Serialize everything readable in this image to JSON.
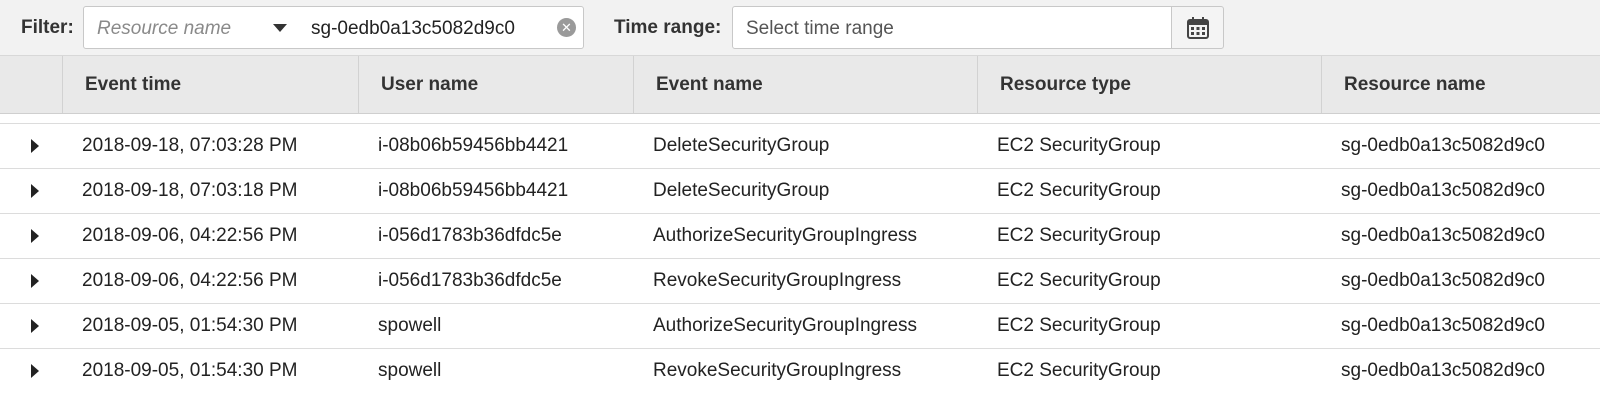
{
  "filter": {
    "label": "Filter:",
    "attribute_placeholder": "Resource name",
    "value": "sg-0edb0a13c5082d9c0",
    "clear_glyph": "✕"
  },
  "time_range": {
    "label": "Time range:",
    "placeholder": "Select time range",
    "icon": "calendar-icon"
  },
  "table": {
    "columns": [
      "Event time",
      "User name",
      "Event name",
      "Resource type",
      "Resource name"
    ],
    "rows": [
      {
        "event_time": "2018-09-18, 07:03:28 PM",
        "user_name": "i-08b06b59456bb4421",
        "event_name": "DeleteSecurityGroup",
        "resource_type": "EC2 SecurityGroup",
        "resource_name": "sg-0edb0a13c5082d9c0"
      },
      {
        "event_time": "2018-09-18, 07:03:18 PM",
        "user_name": "i-08b06b59456bb4421",
        "event_name": "DeleteSecurityGroup",
        "resource_type": "EC2 SecurityGroup",
        "resource_name": "sg-0edb0a13c5082d9c0"
      },
      {
        "event_time": "2018-09-06, 04:22:56 PM",
        "user_name": "i-056d1783b36dfdc5e",
        "event_name": "AuthorizeSecurityGroupIngress",
        "resource_type": "EC2 SecurityGroup",
        "resource_name": "sg-0edb0a13c5082d9c0"
      },
      {
        "event_time": "2018-09-06, 04:22:56 PM",
        "user_name": "i-056d1783b36dfdc5e",
        "event_name": "RevokeSecurityGroupIngress",
        "resource_type": "EC2 SecurityGroup",
        "resource_name": "sg-0edb0a13c5082d9c0"
      },
      {
        "event_time": "2018-09-05, 01:54:30 PM",
        "user_name": "spowell",
        "event_name": "AuthorizeSecurityGroupIngress",
        "resource_type": "EC2 SecurityGroup",
        "resource_name": "sg-0edb0a13c5082d9c0"
      },
      {
        "event_time": "2018-09-05, 01:54:30 PM",
        "user_name": "spowell",
        "event_name": "RevokeSecurityGroupIngress",
        "resource_type": "EC2 SecurityGroup",
        "resource_name": "sg-0edb0a13c5082d9c0"
      }
    ]
  }
}
